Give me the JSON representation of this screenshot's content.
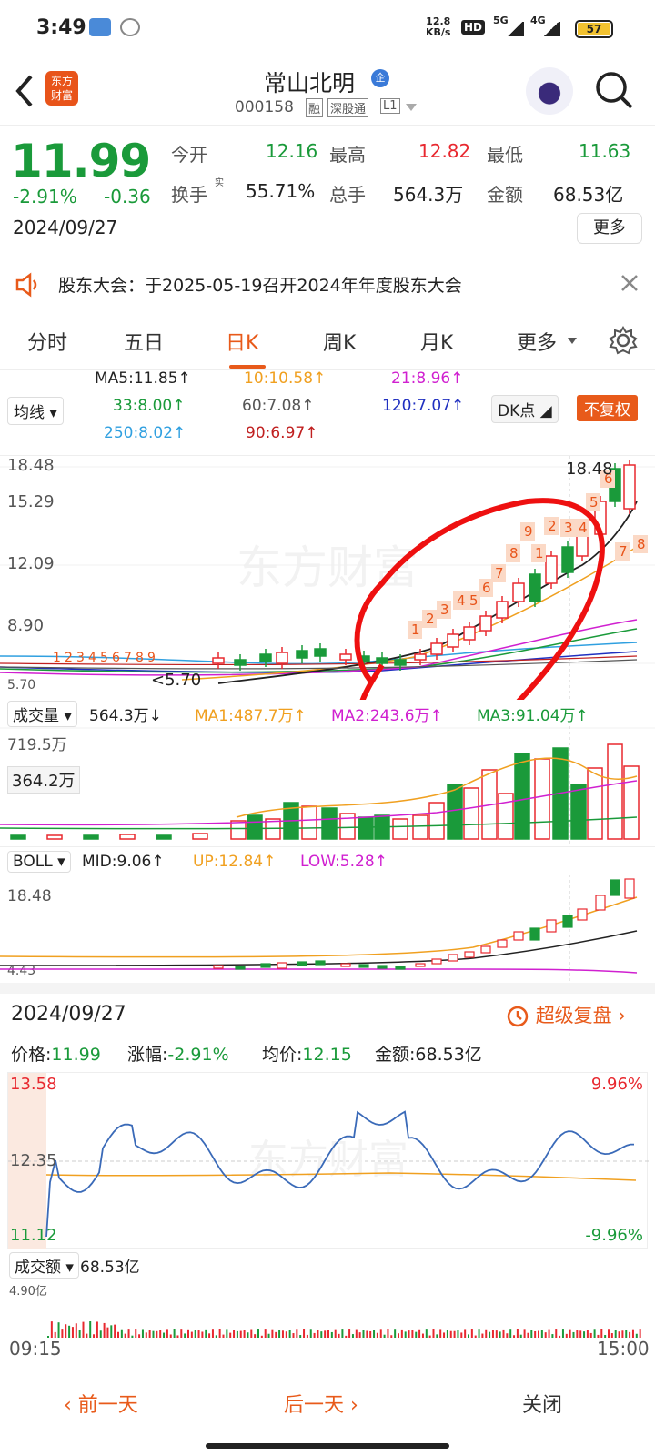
{
  "status": {
    "time": "3:49",
    "net_speed_top": "12.8",
    "net_speed_bottom": "KB/s",
    "signal1": "5G",
    "signal2": "4G",
    "battery": "57"
  },
  "nav": {
    "back_icon": "chevron-left-icon",
    "logo_top": "东方",
    "logo_bottom": "财富",
    "title": "常山北明",
    "title_badge": "企",
    "code": "000158",
    "tag1": "融",
    "tag2": "深股通",
    "tag3": "L1"
  },
  "quote": {
    "price": "11.99",
    "change_pct": "-2.91%",
    "change": "-0.36",
    "date": "2024/09/27",
    "open_label": "今开",
    "open": "12.16",
    "high_label": "最高",
    "high": "12.82",
    "low_label": "最低",
    "low": "11.63",
    "turnover_label": "换手",
    "turnover_sup": "实",
    "turnover": "55.71%",
    "volume_label": "总手",
    "volume": "564.3万",
    "amount_label": "金额",
    "amount": "68.53亿",
    "more": "更多"
  },
  "notice": {
    "text": "股东大会：于2025-05-19召开2024年年度股东大会"
  },
  "tabs": [
    "分时",
    "五日",
    "日K",
    "周K",
    "月K",
    "更多"
  ],
  "ma": {
    "switch": "均线",
    "ma5": "MA5:11.85↑",
    "ma10": "10:10.58↑",
    "ma21": "21:8.96↑",
    "ma33": "33:8.00↑",
    "ma60": "60:7.08↑",
    "ma120": "120:7.07↑",
    "ma250": "250:8.02↑",
    "ma90": "90:6.97↑",
    "dk": "DK点",
    "fq": "不复权",
    "colors": {
      "ma5": "#222222",
      "ma10": "#f0a020",
      "ma21": "#d020d0",
      "ma33": "#1a9a3a",
      "ma60": "#555555",
      "ma120": "#2030c0",
      "ma250": "#30a0e0",
      "ma90": "#c02020"
    }
  },
  "kline": {
    "y1": "18.48",
    "y2": "15.29",
    "y3": "12.09",
    "y4": "8.90",
    "y5": "5.70",
    "low_mark": "5.70",
    "high_mark": "18.48",
    "seq_left": [
      "1",
      "2",
      "3",
      "4",
      "5",
      "6",
      "7",
      "8",
      "9"
    ],
    "seq_right": [
      "1",
      "2",
      "3",
      "4",
      "5",
      "6",
      "7",
      "8",
      "9",
      "1",
      "2",
      "3",
      "4",
      "5",
      "6",
      "7",
      "8"
    ]
  },
  "volume": {
    "label": "成交量",
    "value": "564.3万↓",
    "ma1": "MA1:487.7万↑",
    "ma2": "MA2:243.6万↑",
    "ma3": "MA3:91.04万↑",
    "y_top": "719.5万",
    "y_mid": "364.2万"
  },
  "boll": {
    "label": "BOLL",
    "mid": "MID:9.06↑",
    "up": "UP:12.84↑",
    "low": "LOW:5.28↑",
    "y_top": "18.48",
    "y_bot": "4.43"
  },
  "detail": {
    "date": "2024/09/27",
    "replay": "超级复盘",
    "price_label": "价格:",
    "price": "11.99",
    "chg_label": "涨幅:",
    "chg": "-2.91%",
    "avg_label": "均价:",
    "avg": "12.15",
    "amt_label": "金额:",
    "amt": "68.53亿",
    "y_high": "13.58",
    "y_mid": "12.35",
    "y_low": "11.12",
    "pct_high": "9.96%",
    "pct_low": "-9.96%",
    "amt_switch": "成交额",
    "amt_value": "68.53亿",
    "amt_top": "4.90亿",
    "t_start": "09:15",
    "t_end": "15:00"
  },
  "bottom": {
    "prev": "前一天",
    "next": "后一天",
    "close": "关闭"
  },
  "watermark": "东方财富"
}
